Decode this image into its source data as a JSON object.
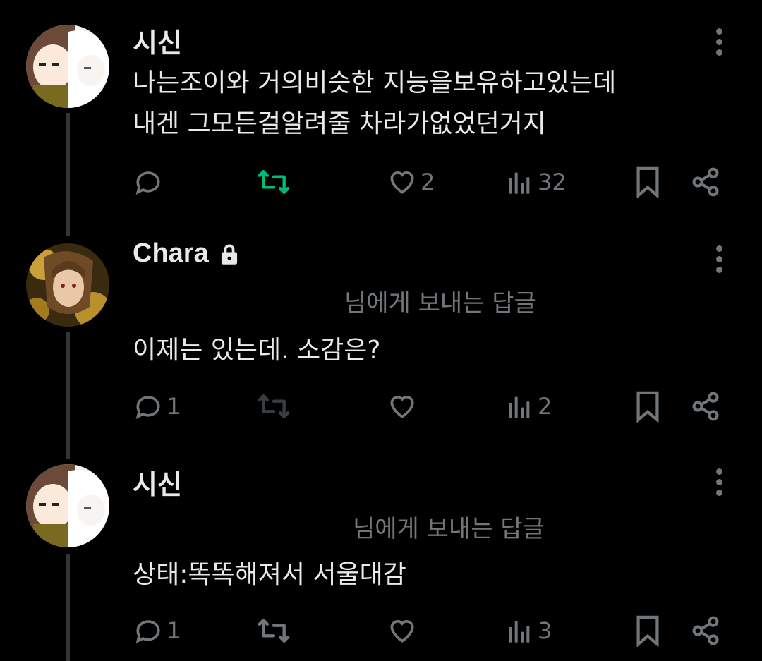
{
  "tweets": [
    {
      "author": "시신",
      "locked": false,
      "replying_to": "",
      "lines": [
        "나는조이와 거의비슷한 지능을보유하고있는데",
        "내겐 그모든걸알려줄 차라가없었던거지"
      ],
      "reply_count": "",
      "retweet_active": true,
      "like_count": "2",
      "view_count": "32"
    },
    {
      "author": "Chara",
      "locked": true,
      "replying_to": "님에게 보내는 답글",
      "lines": [
        "이제는 있는데. 소감은?"
      ],
      "reply_count": "1",
      "retweet_active": false,
      "like_count": "",
      "view_count": "2"
    },
    {
      "author": "시신",
      "locked": false,
      "replying_to": "님에게 보내는 답글",
      "lines": [
        "상태:똑똑해져서 서울대감"
      ],
      "reply_count": "1",
      "retweet_active": false,
      "like_count": "",
      "view_count": "3"
    }
  ],
  "colors": {
    "background": "#000000",
    "text": "#e7e9ea",
    "muted": "#71767b",
    "retweet_active": "#00ba7c",
    "thread_line": "#333639"
  },
  "icons": [
    "reply-icon",
    "retweet-icon",
    "like-icon",
    "views-icon",
    "bookmark-icon",
    "share-icon",
    "more-icon",
    "lock-icon"
  ]
}
